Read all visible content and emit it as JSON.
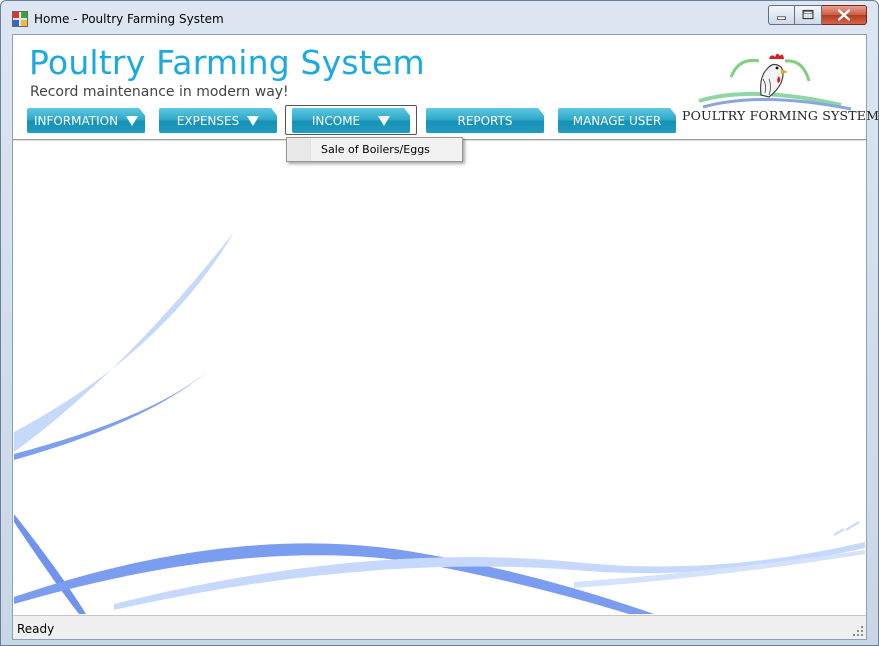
{
  "window": {
    "title": "Home - Poultry Farming System"
  },
  "header": {
    "title": "Poultry Farming System",
    "subtitle": "Record maintenance in modern way!",
    "logo_caption": "POULTRY FORMING SYSTEM"
  },
  "menu": {
    "information": "INFORMATION",
    "expenses": "EXPENSES",
    "income": "INCOME",
    "reports": "REPORTS",
    "manage_user": "MANAGE USER"
  },
  "dropdown": {
    "items": [
      "Sale of Boilers/Eggs"
    ]
  },
  "status": {
    "text": "Ready"
  },
  "colors": {
    "title": "#1ba9e1",
    "menu_button": "#2aa6c7",
    "swoosh": "#4a7fe0"
  }
}
